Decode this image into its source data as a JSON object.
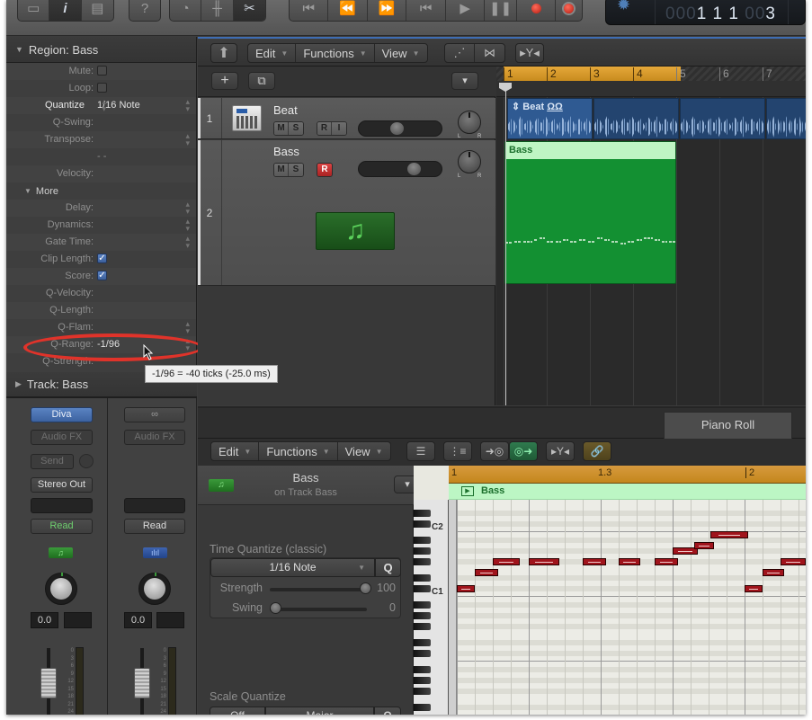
{
  "control_bar": {
    "view_buttons": [
      "library-icon",
      "inspector-icon",
      "editors-icon"
    ],
    "help_button": "help-icon",
    "mixer_buttons": [
      "smart-controls-icon",
      "mixer-icon",
      "editors-scissors-icon"
    ],
    "transport_buttons": [
      "go-to-beginning-icon",
      "rewind-icon",
      "fast-forward-icon",
      "go-to-beginning-alt-icon",
      "play-icon",
      "pause-icon",
      "record-icon",
      "capture-record-icon"
    ],
    "lcd": {
      "position_dim": "000",
      "position_bars": "1 1 1",
      "position_ticks_dim": "00",
      "position_ticks": "3"
    }
  },
  "inspector": {
    "region_header": "Region: Bass",
    "params": [
      {
        "label": "Mute:",
        "type": "checkbox",
        "checked": false
      },
      {
        "label": "Loop:",
        "type": "checkbox",
        "checked": false
      },
      {
        "label": "Quantize",
        "type": "select",
        "value": "1/16 Note",
        "bright": true
      },
      {
        "label": "Q-Swing:",
        "type": "text",
        "value": ""
      },
      {
        "label": "Transpose:",
        "type": "select",
        "value": ""
      },
      {
        "label": "",
        "type": "text",
        "value": "- -"
      },
      {
        "label": "Velocity:",
        "type": "text",
        "value": ""
      }
    ],
    "more_label": "More",
    "more_params": [
      {
        "label": "Delay:",
        "type": "select",
        "value": ""
      },
      {
        "label": "Dynamics:",
        "type": "select",
        "value": ""
      },
      {
        "label": "Gate Time:",
        "type": "select",
        "value": ""
      },
      {
        "label": "Clip Length:",
        "type": "checkbox",
        "checked": true
      },
      {
        "label": "Score:",
        "type": "checkbox",
        "checked": true
      },
      {
        "label": "Q-Velocity:",
        "type": "text",
        "value": ""
      },
      {
        "label": "Q-Length:",
        "type": "text",
        "value": ""
      },
      {
        "label": "Q-Flam:",
        "type": "select",
        "value": ""
      },
      {
        "label": "Q-Range:",
        "type": "select",
        "value": "-1/96"
      },
      {
        "label": "Q-Strength:",
        "type": "text",
        "value": ""
      }
    ],
    "tooltip": "-1/96 = -40 ticks (-25.0 ms)",
    "track_header": "Track:  Bass",
    "strips": [
      {
        "instrument": "Diva",
        "audio_fx": "Audio FX",
        "send": "Send",
        "output": "Stereo Out",
        "automation": "Read",
        "volume": "0.0",
        "type_icon": "midi-instrument-icon"
      },
      {
        "instrument": "stereo-link-icon",
        "audio_fx": "Audio FX",
        "output": "",
        "automation": "Read",
        "volume": "0.0",
        "type_icon": "audio-waveform-icon"
      }
    ],
    "meter_scale": [
      "0",
      "3",
      "6",
      "9",
      "12",
      "15",
      "18",
      "21",
      "24"
    ]
  },
  "tracks_area": {
    "toolbar": {
      "menus": [
        "Edit",
        "Functions",
        "View"
      ]
    },
    "tracks": [
      {
        "number": "1",
        "name": "Beat",
        "buttons": [
          "M",
          "S",
          "R",
          "I"
        ],
        "volume": 0.45
      },
      {
        "number": "2",
        "name": "Bass",
        "buttons": [
          "M",
          "S",
          "R"
        ],
        "volume": 0.7
      }
    ],
    "ruler": [
      "1",
      "2",
      "3",
      "4",
      "5",
      "6",
      "7"
    ],
    "regions": {
      "beat_name": "Beat",
      "bass_name": "Bass"
    }
  },
  "editor": {
    "tab_label": "Piano Roll",
    "toolbar": {
      "menus": [
        "Edit",
        "Functions",
        "View"
      ]
    },
    "region_name": "Bass",
    "region_sub": "on Track Bass",
    "time_quantize": {
      "label": "Time Quantize (classic)",
      "value": "1/16 Note",
      "q_button": "Q",
      "strength_label": "Strength",
      "strength": 100,
      "swing_label": "Swing",
      "swing": 0
    },
    "scale_quantize": {
      "label": "Scale Quantize",
      "mode": "Off",
      "scale": "Major",
      "q_button": "Q"
    },
    "ruler": [
      "1",
      "1.3",
      "2"
    ],
    "region_label": "Bass",
    "key_labels": [
      "C2",
      "C1"
    ],
    "notes": [
      {
        "pitch": "C#1",
        "start": 0,
        "len": 1
      },
      {
        "pitch": "E1",
        "start": 1,
        "len": 1.3
      },
      {
        "pitch": "F#1",
        "start": 2,
        "len": 1.5
      },
      {
        "pitch": "F#1",
        "start": 4,
        "len": 1.7
      },
      {
        "pitch": "F#1",
        "start": 7,
        "len": 1.3
      },
      {
        "pitch": "F#1",
        "start": 9,
        "len": 1.2
      },
      {
        "pitch": "F#1",
        "start": 11,
        "len": 1.3
      },
      {
        "pitch": "G#1",
        "start": 12,
        "len": 1.4
      },
      {
        "pitch": "A1",
        "start": 13.2,
        "len": 1.1
      },
      {
        "pitch": "B1",
        "start": 14.1,
        "len": 2.1
      },
      {
        "pitch": "C#1",
        "start": 16,
        "len": 1
      },
      {
        "pitch": "E1",
        "start": 17,
        "len": 1.2
      },
      {
        "pitch": "F#1",
        "start": 18,
        "len": 1.4
      }
    ]
  }
}
